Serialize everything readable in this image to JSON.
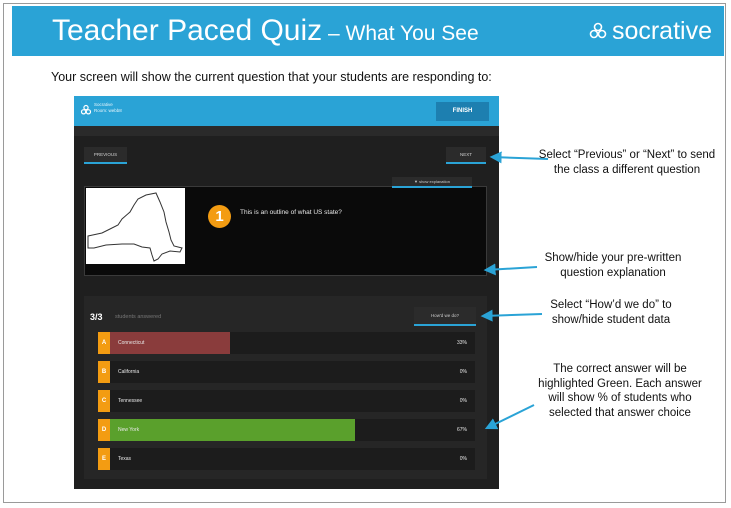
{
  "banner": {
    "title": "Teacher Paced Quiz",
    "title_sep": " – ",
    "subtitle": "What You See",
    "brand": "socrative"
  },
  "intro": "Your screen will show the current question that your students are responding to:",
  "app": {
    "room_line1": "Socrative",
    "room_line2": "Room: webb8",
    "finish_label": "FINISH",
    "prev_label": "PREVIOUS",
    "next_label": "NEXT",
    "question_number": "1",
    "question_text": "This is an outline of what US state?",
    "explanation_label": "▼ show explanation",
    "answered_count": "3/3",
    "answered_label": "students answered",
    "howd_label": "How'd we do?",
    "answers": [
      {
        "letter": "A",
        "text": "Connecticut",
        "percent_label": "33%",
        "fraction": 0.33,
        "color": "#8a3c3c"
      },
      {
        "letter": "B",
        "text": "California",
        "percent_label": "0%",
        "fraction": 0,
        "color": "#8a3c3c"
      },
      {
        "letter": "C",
        "text": "Tennessee",
        "percent_label": "0%",
        "fraction": 0,
        "color": "#8a3c3c"
      },
      {
        "letter": "D",
        "text": "New York",
        "percent_label": "67%",
        "fraction": 0.67,
        "color": "#5aa02c"
      },
      {
        "letter": "E",
        "text": "Texas",
        "percent_label": "0%",
        "fraction": 0,
        "color": "#8a3c3c"
      }
    ]
  },
  "notes": {
    "prev_next": "Select “Previous” or “Next” to send the class a different question",
    "explanation": "Show/hide your pre-written question explanation",
    "howd": "Select “How’d we do” to show/hide student data",
    "correct": "The correct answer will be highlighted Green. Each answer will show % of students who selected that answer choice"
  },
  "colors": {
    "brand_blue": "#2aa3d6",
    "orange": "#f39c12",
    "correct_green": "#5aa02c",
    "wrong_red": "#8a3c3c",
    "arrow_blue": "#2aa3d6"
  }
}
